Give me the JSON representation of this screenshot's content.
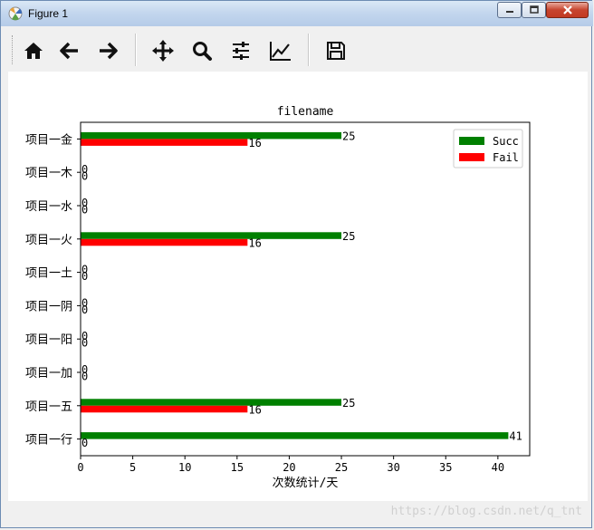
{
  "window": {
    "title": "Figure 1"
  },
  "toolbar": {
    "items": [
      {
        "icon": "home-icon"
      },
      {
        "icon": "back-arrow-icon"
      },
      {
        "icon": "forward-arrow-icon"
      },
      {
        "icon": "pan-move-icon"
      },
      {
        "icon": "zoom-icon"
      },
      {
        "icon": "subplots-config-icon"
      },
      {
        "icon": "edit-axis-icon"
      },
      {
        "icon": "save-icon"
      }
    ]
  },
  "watermark": "https://blog.csdn.net/q_tnt",
  "chart_data": {
    "type": "bar",
    "orientation": "horizontal",
    "title": "filename",
    "xlabel": "次数统计/天",
    "ylabel": "",
    "categories": [
      "项目一行",
      "项目一五",
      "项目一加",
      "项目一阳",
      "项目一阴",
      "项目一土",
      "项目一火",
      "项目一水",
      "项目一木",
      "项目一金"
    ],
    "series": [
      {
        "name": "Succ",
        "color": "#008000",
        "values": [
          41,
          25,
          0,
          0,
          0,
          0,
          25,
          0,
          0,
          25
        ]
      },
      {
        "name": "Fail",
        "color": "#ff0000",
        "values": [
          0,
          16,
          0,
          0,
          0,
          0,
          16,
          0,
          0,
          16
        ]
      }
    ],
    "xlim": [
      0,
      43.05
    ],
    "xticks": [
      0,
      5,
      10,
      15,
      20,
      25,
      30,
      35,
      40
    ],
    "legend_position": "top-right",
    "grid": false
  }
}
